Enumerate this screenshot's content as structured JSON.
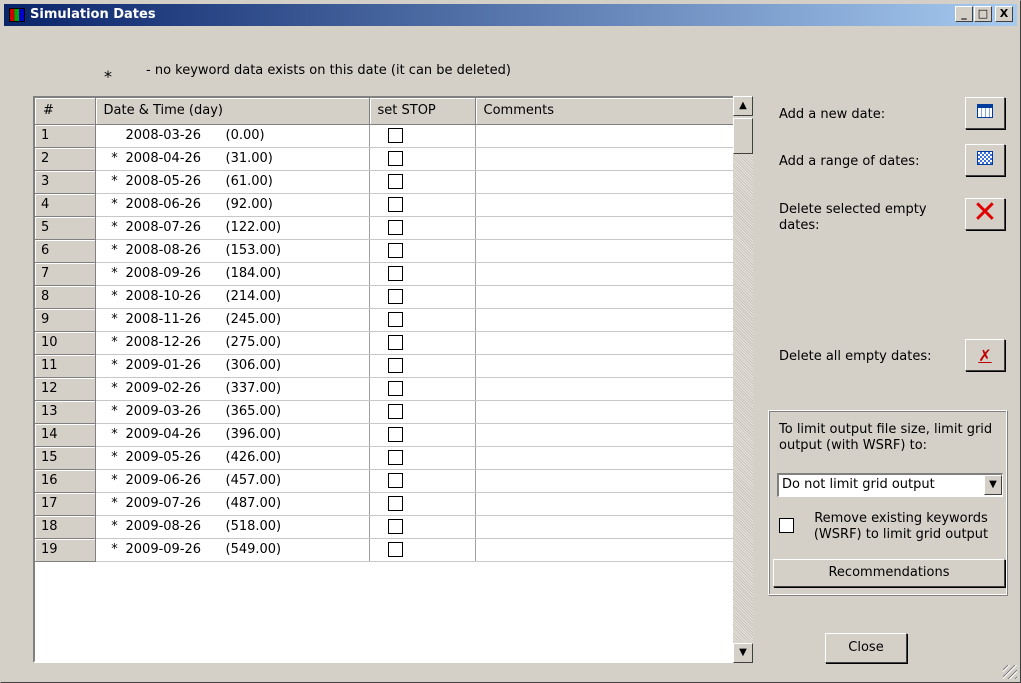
{
  "window": {
    "title": "Simulation Dates",
    "minimize": "_",
    "maximize": "□",
    "close": "X"
  },
  "legend": {
    "symbol": "*",
    "text": "- no keyword data exists on this date (it can be deleted)"
  },
  "table": {
    "columns": [
      "#",
      "Date & Time (day)",
      "set STOP",
      "Comments"
    ],
    "rows": [
      {
        "n": "1",
        "star": "",
        "date": "2008-03-26",
        "days": "(0.00)"
      },
      {
        "n": "2",
        "star": "*",
        "date": "2008-04-26",
        "days": "(31.00)"
      },
      {
        "n": "3",
        "star": "*",
        "date": "2008-05-26",
        "days": "(61.00)"
      },
      {
        "n": "4",
        "star": "*",
        "date": "2008-06-26",
        "days": "(92.00)"
      },
      {
        "n": "5",
        "star": "*",
        "date": "2008-07-26",
        "days": "(122.00)"
      },
      {
        "n": "6",
        "star": "*",
        "date": "2008-08-26",
        "days": "(153.00)"
      },
      {
        "n": "7",
        "star": "*",
        "date": "2008-09-26",
        "days": "(184.00)"
      },
      {
        "n": "8",
        "star": "*",
        "date": "2008-10-26",
        "days": "(214.00)"
      },
      {
        "n": "9",
        "star": "*",
        "date": "2008-11-26",
        "days": "(245.00)"
      },
      {
        "n": "10",
        "star": "*",
        "date": "2008-12-26",
        "days": "(275.00)"
      },
      {
        "n": "11",
        "star": "*",
        "date": "2009-01-26",
        "days": "(306.00)"
      },
      {
        "n": "12",
        "star": "*",
        "date": "2009-02-26",
        "days": "(337.00)"
      },
      {
        "n": "13",
        "star": "*",
        "date": "2009-03-26",
        "days": "(365.00)"
      },
      {
        "n": "14",
        "star": "*",
        "date": "2009-04-26",
        "days": "(396.00)"
      },
      {
        "n": "15",
        "star": "*",
        "date": "2009-05-26",
        "days": "(426.00)"
      },
      {
        "n": "16",
        "star": "*",
        "date": "2009-06-26",
        "days": "(457.00)"
      },
      {
        "n": "17",
        "star": "*",
        "date": "2009-07-26",
        "days": "(487.00)"
      },
      {
        "n": "18",
        "star": "*",
        "date": "2009-08-26",
        "days": "(518.00)"
      },
      {
        "n": "19",
        "star": "*",
        "date": "2009-09-26",
        "days": "(549.00)"
      }
    ]
  },
  "actions": {
    "add_date": "Add a new date:",
    "add_range": "Add a range of dates:",
    "delete_selected": "Delete selected empty dates:",
    "delete_all": "Delete all empty dates:"
  },
  "output_limit": {
    "description": "To limit output file size, limit grid output (with WSRF) to:",
    "selected": "Do not limit grid output",
    "checkbox_label": "Remove existing keywords (WSRF) to limit grid output",
    "recommendations": "Recommendations"
  },
  "close_label": "Close",
  "icons": {
    "add_date": "calendar-icon",
    "add_range": "calendar-range-icon",
    "delete_selected": "red-x-icon",
    "delete_all": "small-x-icon"
  }
}
